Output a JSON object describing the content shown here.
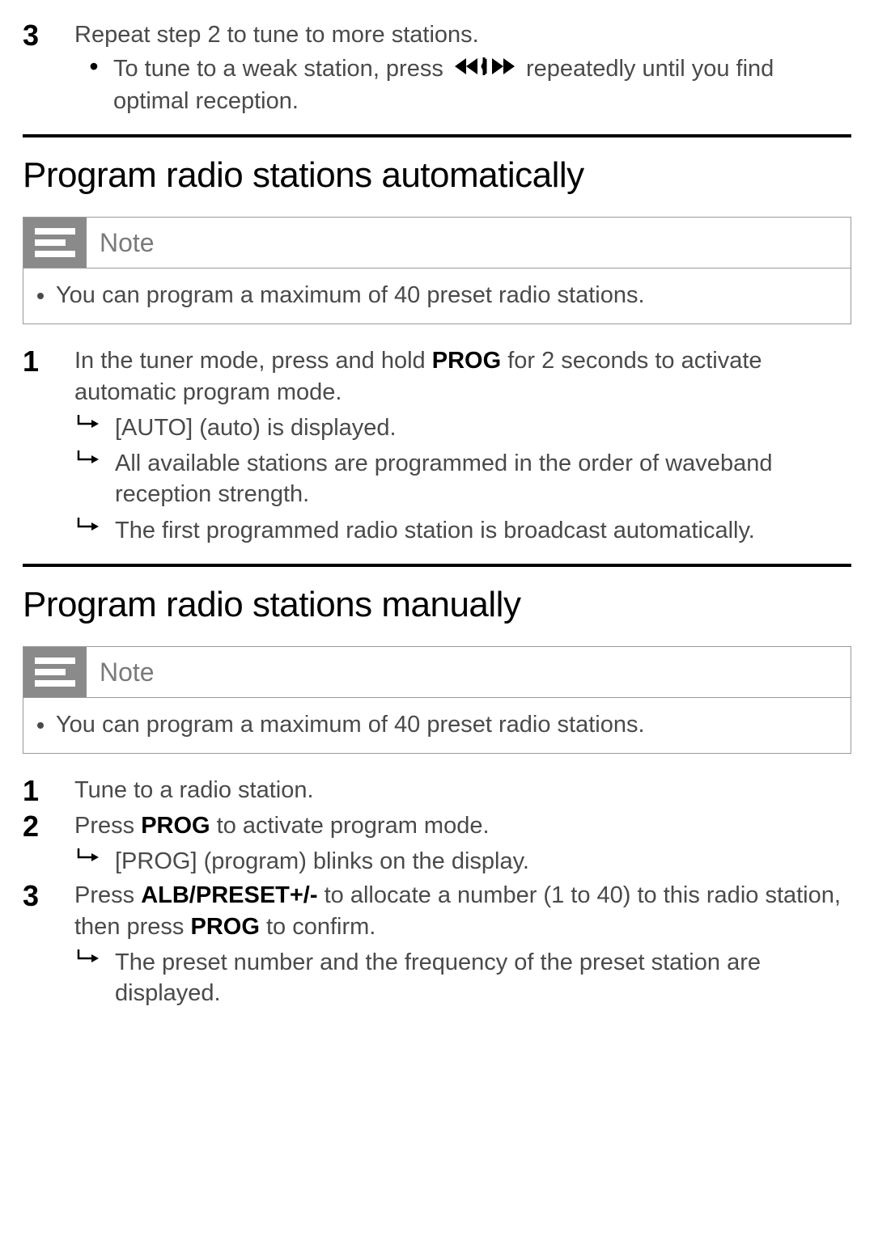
{
  "step_top": {
    "num": "3",
    "text": "Repeat step 2 to tune to more stations.",
    "bullet_pre": "To tune to a weak station, press ",
    "bullet_post": " repeatedly until you find optimal reception."
  },
  "section_auto": {
    "title": "Program radio stations automatically",
    "note_label": "Note",
    "note_item": "You can program a maximum of 40 preset radio stations.",
    "step1": {
      "num": "1",
      "pre": "In the tuner mode, press and hold ",
      "prog": "PROG",
      "post": " for 2 seconds to activate automatic program mode.",
      "r1": "[AUTO] (auto) is displayed.",
      "r2": "All available stations are programmed in the order of waveband reception strength.",
      "r3": "The first programmed radio station is broadcast automatically."
    }
  },
  "section_manual": {
    "title": "Program radio stations manually",
    "note_label": "Note",
    "note_item": "You can program a maximum of 40 preset radio stations.",
    "step1": {
      "num": "1",
      "text": "Tune to a radio station."
    },
    "step2": {
      "num": "2",
      "pre": "Press ",
      "prog": "PROG",
      "post": " to activate program mode.",
      "r1": "[PROG] (program) blinks on the display."
    },
    "step3": {
      "num": "3",
      "pre": "Press ",
      "alb": "ALB/PRESET+/-",
      "mid": " to allocate a number (1 to 40) to this radio station, then press ",
      "prog": "PROG",
      "post": " to confirm.",
      "r1": "The preset number and the frequency of the preset station are displayed."
    }
  }
}
